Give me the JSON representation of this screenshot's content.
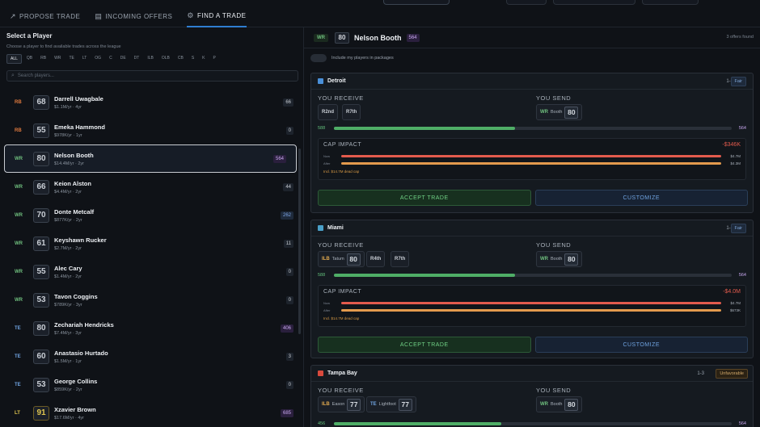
{
  "tabs": [
    {
      "label": "PROPOSE TRADE",
      "icon": "trend-up-icon"
    },
    {
      "label": "INCOMING OFFERS",
      "icon": "document-icon"
    },
    {
      "label": "FIND A TRADE",
      "icon": "gear-icon",
      "active": true
    }
  ],
  "left": {
    "title": "Select a Player",
    "subtitle": "Choose a player to find available trades across the league",
    "positions": [
      "ALL",
      "QB",
      "RB",
      "WR",
      "TE",
      "LT",
      "OG",
      "C",
      "DE",
      "DT",
      "ILB",
      "OLB",
      "CB",
      "S",
      "K",
      "P"
    ],
    "search_placeholder": "Search players...",
    "players": [
      {
        "pos": "RB",
        "ovr": "68",
        "name": "Darrell Uwagbale",
        "meta": "$1.1M/yr · 4yr",
        "badge": "66",
        "pos_color": "#e07a3e",
        "badge_color": "#c7ccd3"
      },
      {
        "pos": "RB",
        "ovr": "55",
        "name": "Emeka Hammond",
        "meta": "$978K/yr · 1yr",
        "badge": "0",
        "pos_color": "#e07a3e",
        "badge_color": "#c7ccd3"
      },
      {
        "pos": "WR",
        "ovr": "80",
        "name": "Nelson Booth",
        "meta": "$14.4M/yr · 2yr",
        "badge": "564",
        "pos_color": "#6fbf7e",
        "badge_color": "#c9a8f0",
        "selected": true
      },
      {
        "pos": "WR",
        "ovr": "66",
        "name": "Keion Alston",
        "meta": "$4.4M/yr · 2yr",
        "badge": "44",
        "pos_color": "#6fbf7e",
        "badge_color": "#c7ccd3"
      },
      {
        "pos": "WR",
        "ovr": "70",
        "name": "Donte Metcalf",
        "meta": "$877K/yr · 2yr",
        "badge": "262",
        "pos_color": "#6fbf7e",
        "badge_color": "#7fa7e8"
      },
      {
        "pos": "WR",
        "ovr": "61",
        "name": "Keyshawn Rucker",
        "meta": "$2.7M/yr · 2yr",
        "badge": "11",
        "pos_color": "#6fbf7e",
        "badge_color": "#c7ccd3"
      },
      {
        "pos": "WR",
        "ovr": "55",
        "name": "Alec Cary",
        "meta": "$1.4M/yr · 2yr",
        "badge": "0",
        "pos_color": "#6fbf7e",
        "badge_color": "#c7ccd3"
      },
      {
        "pos": "WR",
        "ovr": "53",
        "name": "Tavon Coggins",
        "meta": "$789K/yr · 3yr",
        "badge": "0",
        "pos_color": "#6fbf7e",
        "badge_color": "#c7ccd3"
      },
      {
        "pos": "TE",
        "ovr": "80",
        "name": "Zechariah Hendricks",
        "meta": "$7.4M/yr · 3yr",
        "badge": "406",
        "pos_color": "#6fa3e0",
        "badge_color": "#c9a8f0"
      },
      {
        "pos": "TE",
        "ovr": "60",
        "name": "Anastasio Hurtado",
        "meta": "$1.5M/yr · 1yr",
        "badge": "3",
        "pos_color": "#6fa3e0",
        "badge_color": "#c7ccd3"
      },
      {
        "pos": "TE",
        "ovr": "53",
        "name": "George Collins",
        "meta": "$859K/yr · 2yr",
        "badge": "0",
        "pos_color": "#6fa3e0",
        "badge_color": "#c7ccd3"
      },
      {
        "pos": "LT",
        "ovr": "91",
        "name": "Xzavier Brown",
        "meta": "$17.6M/yr · 4yr",
        "badge": "685",
        "pos_color": "#e0c64f",
        "badge_color": "#c9a8f0"
      }
    ]
  },
  "right": {
    "pos": "WR",
    "ovr": "80",
    "name": "Nelson Booth",
    "value": "564",
    "count": "3 offers found",
    "toggle_label": "Include my players in packages",
    "you_receive": "YOU RECEIVE",
    "you_send": "YOU SEND",
    "cap_impact": "CAP IMPACT",
    "before": "Now",
    "after": "After",
    "accept": "ACCEPT TRADE",
    "customize": "CUSTOMIZE",
    "offers": [
      {
        "team": "Detroit",
        "color": "#4a90d9",
        "rank": "1-3",
        "fair": "Fair",
        "receive_chips": [
          {
            "text": "R2nd"
          },
          {
            "text": "R7th"
          }
        ],
        "send_chip": {
          "pos": "WR",
          "name": "Booth",
          "ovr": "80"
        },
        "val_left": "588",
        "val_right": "564",
        "fill": 0.455,
        "delta": "-$346K",
        "before_val": "$4.7M",
        "after_val": "$4.3M",
        "dead": "Incl. $14.7M dead cap"
      },
      {
        "team": "Miami",
        "color": "#4aa0c8",
        "rank": "1-3",
        "fair": "Fair",
        "receive_chips": [
          {
            "pos": "ILB",
            "name": "Tatum",
            "ovr": "80"
          },
          {
            "text": "R4th"
          },
          {
            "text": "R7th"
          }
        ],
        "send_chip": {
          "pos": "WR",
          "name": "Booth",
          "ovr": "80"
        },
        "val_left": "588",
        "val_right": "564",
        "fill": 0.455,
        "delta": "-$4.0M",
        "before_val": "$4.7M",
        "after_val": "$673K",
        "dead": "Incl. $14.7M dead cap"
      },
      {
        "team": "Tampa Bay",
        "color": "#d94a3d",
        "rank": "1-3",
        "fair": "Unfavorable",
        "receive_chips": [
          {
            "pos": "ILB",
            "name": "Eason",
            "ovr": "77"
          },
          {
            "pos": "TE",
            "name": "Lightfoot",
            "ovr": "77"
          }
        ],
        "send_chip": {
          "pos": "WR",
          "name": "Booth",
          "ovr": "80"
        },
        "val_left": "456",
        "val_right": "564",
        "fill": 0.42
      }
    ]
  }
}
